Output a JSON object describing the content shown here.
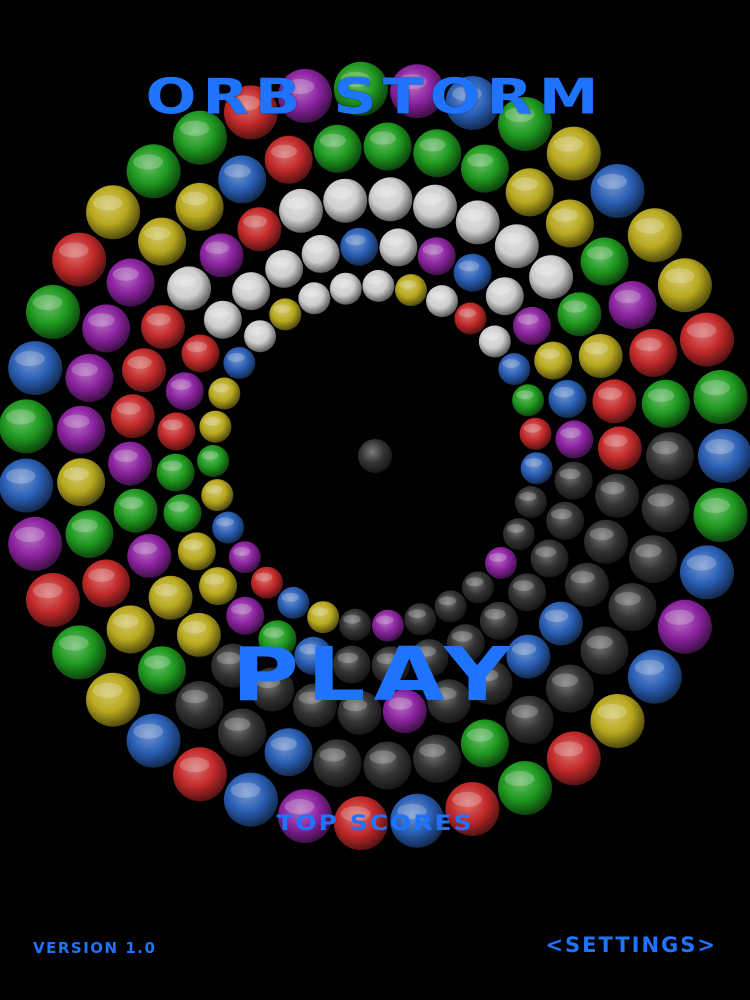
{
  "game": {
    "title": "ORB STORM",
    "play_label": "PLAY",
    "top_scores_label": "TOP SCORES",
    "version_label": "VERSION 1.0",
    "settings_label": "<SETTINGS>"
  },
  "colors": {
    "background": "#000000",
    "text_accent": "#1e73ff",
    "orb_red": "#c42a2a",
    "orb_green": "#1f9a1f",
    "orb_blue": "#2a5fb5",
    "orb_yellow": "#b9a91f",
    "orb_purple": "#8c23a0",
    "orb_white": "#cfcfcf",
    "orb_gray": "#333333"
  },
  "orb_types": [
    "red",
    "green",
    "blue",
    "yellow",
    "purple",
    "white",
    "gray"
  ]
}
